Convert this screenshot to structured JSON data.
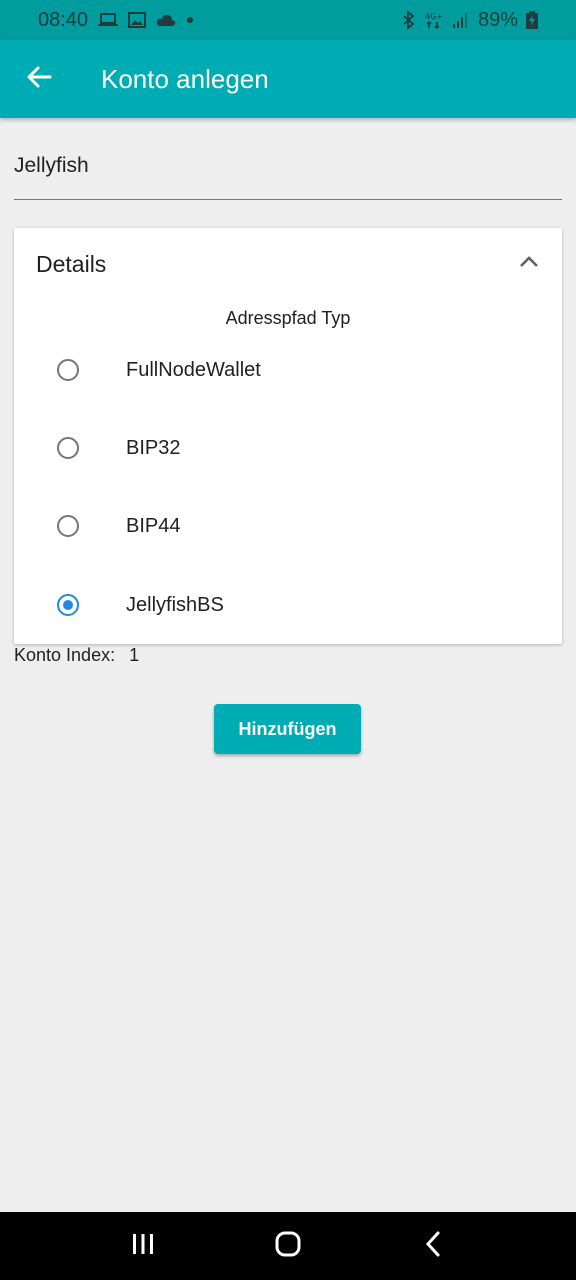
{
  "status_bar": {
    "time": "08:40",
    "battery": "89%",
    "icons": [
      "laptop-icon",
      "image-icon",
      "cloud-icon",
      "dot-icon",
      "bluetooth-icon",
      "4g-icon",
      "signal-icon",
      "battery-charging-icon"
    ]
  },
  "app_bar": {
    "title": "Konto anlegen",
    "back_icon": "arrow-back-icon"
  },
  "name_field": {
    "value": "Jellyfish"
  },
  "details": {
    "title": "Details",
    "collapse_icon": "chevron-up-icon",
    "address_path_label": "Adresspfad Typ",
    "options": [
      {
        "label": "FullNodeWallet",
        "checked": false
      },
      {
        "label": "BIP32",
        "checked": false
      },
      {
        "label": "BIP44",
        "checked": false
      },
      {
        "label": "JellyfishBS",
        "checked": true
      }
    ]
  },
  "account_index": {
    "label": "Konto Index:",
    "value": "1"
  },
  "add_button": {
    "label": "Hinzufügen"
  },
  "nav_bar": {
    "icons": [
      "recent-apps-icon",
      "home-icon",
      "back-icon"
    ]
  },
  "colors": {
    "accent": "#00acb3",
    "status_bar": "#009c9e",
    "radio_checked": "#1e88e5",
    "background": "#eeeeee"
  }
}
